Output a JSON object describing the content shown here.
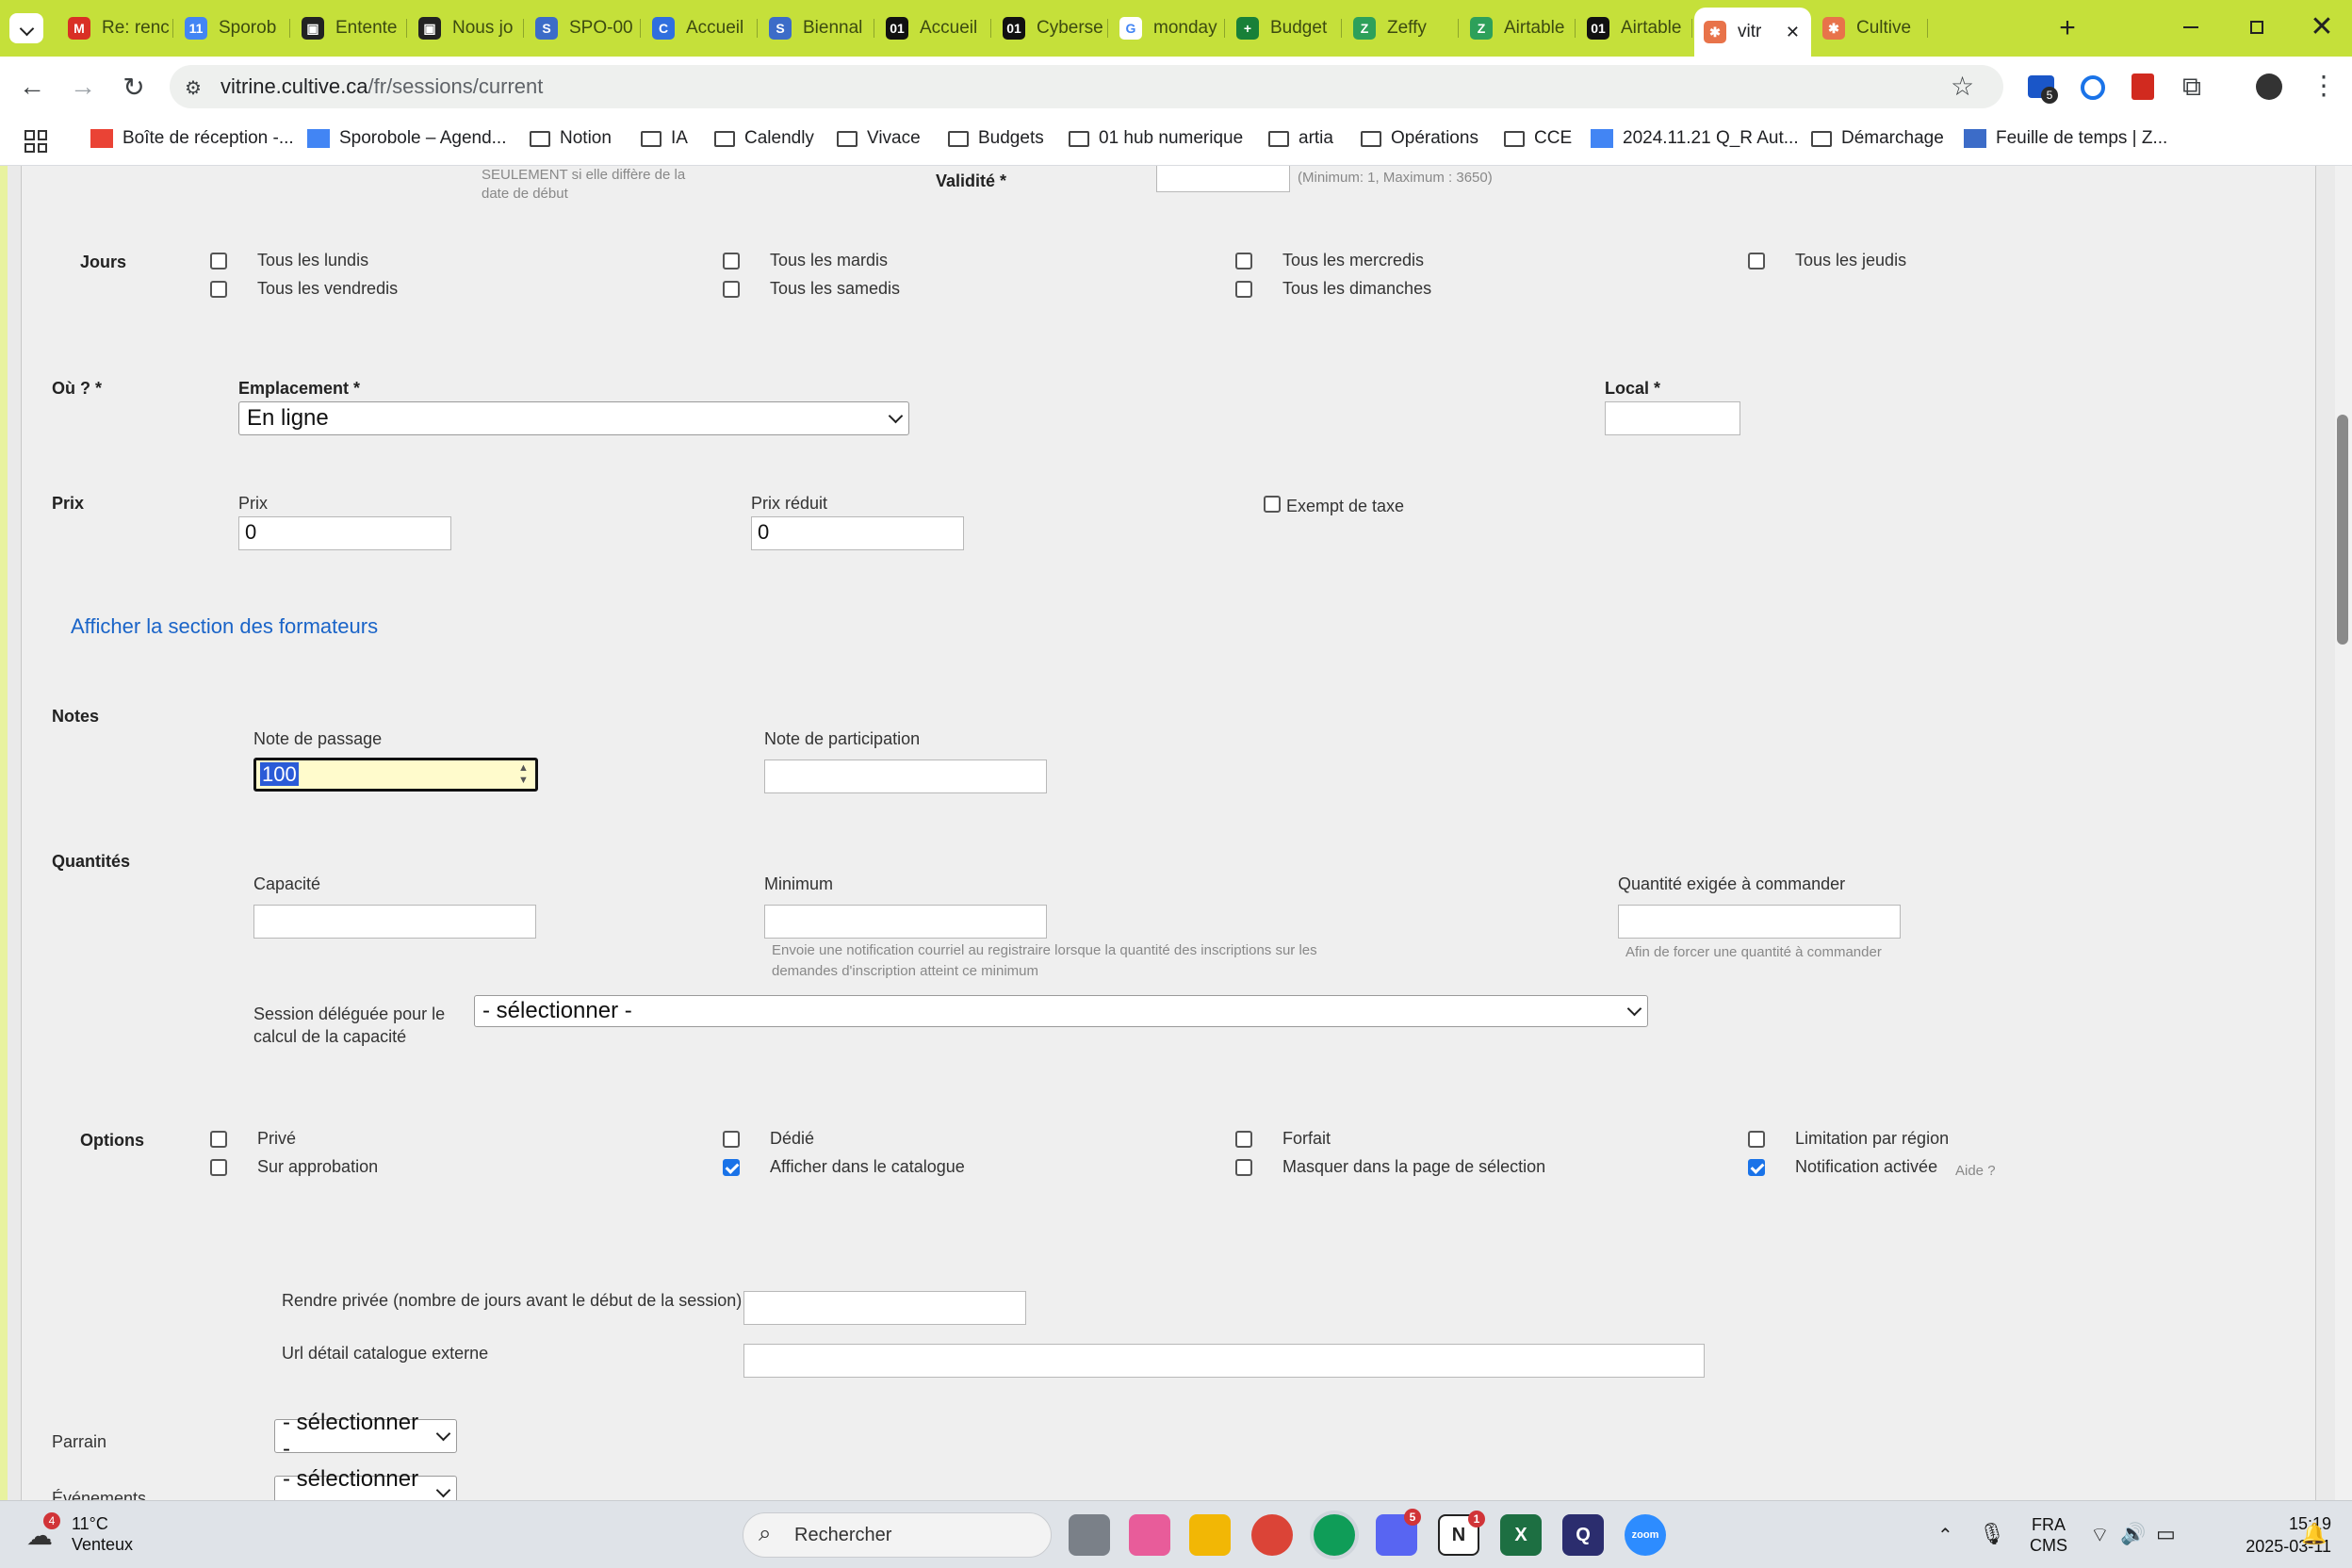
{
  "browser": {
    "tabs": [
      {
        "label": "Re: renc",
        "color": "#d93025",
        "glyph": "M"
      },
      {
        "label": "Sporob",
        "color": "#4285f4",
        "glyph": "11"
      },
      {
        "label": "Entente",
        "color": "#222222",
        "glyph": "▣"
      },
      {
        "label": "Nous jo",
        "color": "#222222",
        "glyph": "▣"
      },
      {
        "label": "SPO-00",
        "color": "#3c6cc8",
        "glyph": "S"
      },
      {
        "label": "Accueil",
        "color": "#2f6fdf",
        "glyph": "C"
      },
      {
        "label": "Biennal",
        "color": "#3c6cc8",
        "glyph": "S"
      },
      {
        "label": "Accueil",
        "color": "#111111",
        "glyph": "01"
      },
      {
        "label": "Cyberse",
        "color": "#111111",
        "glyph": "01"
      },
      {
        "label": "monday",
        "color": "#ffffff",
        "glyph": "G"
      },
      {
        "label": "Budget",
        "color": "#188038",
        "glyph": "+"
      },
      {
        "label": "Zeffy",
        "color": "#2da05a",
        "glyph": "Z"
      },
      {
        "label": "Airtable",
        "color": "#2da05a",
        "glyph": "Z"
      },
      {
        "label": "Airtable",
        "color": "#111111",
        "glyph": "01"
      },
      {
        "label": "vitr",
        "color": "#e8734a",
        "glyph": "✱"
      },
      {
        "label": "Cultive",
        "color": "#e8734a",
        "glyph": "✱"
      }
    ],
    "new_tab_label": "+",
    "url_host": "vitrine.cultive.ca",
    "url_path": "/fr/sessions/current",
    "extension_badge": "5",
    "bookmarks": [
      {
        "label": "Boîte de réception -...",
        "icon": "gmail-icon"
      },
      {
        "label": "Sporobole – Agend...",
        "icon": "calendar-icon"
      },
      {
        "label": "Notion",
        "icon": "folder-icon"
      },
      {
        "label": "IA",
        "icon": "folder-icon"
      },
      {
        "label": "Calendly",
        "icon": "folder-icon"
      },
      {
        "label": "Vivace",
        "icon": "folder-icon"
      },
      {
        "label": "Budgets",
        "icon": "folder-icon"
      },
      {
        "label": "01 hub numerique",
        "icon": "folder-icon"
      },
      {
        "label": "artia",
        "icon": "folder-icon"
      },
      {
        "label": "Opérations",
        "icon": "folder-icon"
      },
      {
        "label": "CCE",
        "icon": "folder-icon"
      },
      {
        "label": "2024.11.21 Q_R Aut...",
        "icon": "docs-icon"
      },
      {
        "label": "Démarchage",
        "icon": "folder-icon"
      },
      {
        "label": "Feuille de temps | Z...",
        "icon": "zeffy-icon"
      }
    ]
  },
  "form": {
    "top_hint_line1": "SEULEMENT si elle diffère de la",
    "top_hint_line2": "date de début",
    "validite_label": "Validité *",
    "validite_hint": "(Minimum: 1, Maximum : 3650)",
    "jours_label": "Jours",
    "jours": [
      {
        "label": "Tous les lundis",
        "checked": false
      },
      {
        "label": "Tous les mardis",
        "checked": false
      },
      {
        "label": "Tous les mercredis",
        "checked": false
      },
      {
        "label": "Tous les jeudis",
        "checked": false
      },
      {
        "label": "Tous les vendredis",
        "checked": false
      },
      {
        "label": "Tous les samedis",
        "checked": false
      },
      {
        "label": "Tous les dimanches",
        "checked": false
      }
    ],
    "ou_label": "Où ? *",
    "emplacement_label": "Emplacement *",
    "emplacement_value": "En ligne",
    "local_label": "Local *",
    "prix_section": "Prix",
    "prix_label": "Prix",
    "prix_value": "0",
    "prix_reduit_label": "Prix réduit",
    "prix_reduit_value": "0",
    "exempt_label": "Exempt de taxe",
    "formateurs_link": "Afficher la section des formateurs",
    "notes_label": "Notes",
    "note_passage_label": "Note de passage",
    "note_passage_value": "100",
    "note_participation_label": "Note de participation",
    "quantites_label": "Quantités",
    "capacite_label": "Capacité",
    "minimum_label": "Minimum",
    "minimum_hint_line1": "Envoie une notification courriel au registraire lorsque la quantité des inscriptions sur les",
    "minimum_hint_line2": "demandes d'inscription atteint ce minimum",
    "qte_label": "Quantité exigée à commander",
    "qte_hint": "Afin de forcer une quantité à commander",
    "session_deleguee_line1": "Session déléguée pour le",
    "session_deleguee_line2": "calcul de la capacité",
    "session_deleguee_value": "- sélectionner -",
    "options_label": "Options",
    "options": [
      {
        "label": "Privé",
        "checked": false
      },
      {
        "label": "Dédié",
        "checked": false
      },
      {
        "label": "Forfait",
        "checked": false
      },
      {
        "label": "Limitation par région",
        "checked": false
      },
      {
        "label": "Sur approbation",
        "checked": false
      },
      {
        "label": "Afficher dans le catalogue",
        "checked": true
      },
      {
        "label": "Masquer dans la page de sélection",
        "checked": false
      },
      {
        "label": "Notification activée",
        "checked": true
      }
    ],
    "aide_link": "Aide ?",
    "rendre_privee_label": "Rendre privée (nombre de jours avant le début de la session)",
    "url_externe_label": "Url détail catalogue externe",
    "parrain_label": "Parrain",
    "parrain_value": "- sélectionner -",
    "evenements_label": "Événements",
    "evenements_value": "- sélectionner -"
  },
  "taskbar": {
    "weather_temp": "11°C",
    "weather_desc": "Venteux",
    "weather_badge": "4",
    "search_placeholder": "Rechercher",
    "lang_top": "FRA",
    "lang_bottom": "CMS",
    "time": "15:19",
    "date": "2025-03-11",
    "discord_badge": "5",
    "notion_badge": "1"
  }
}
